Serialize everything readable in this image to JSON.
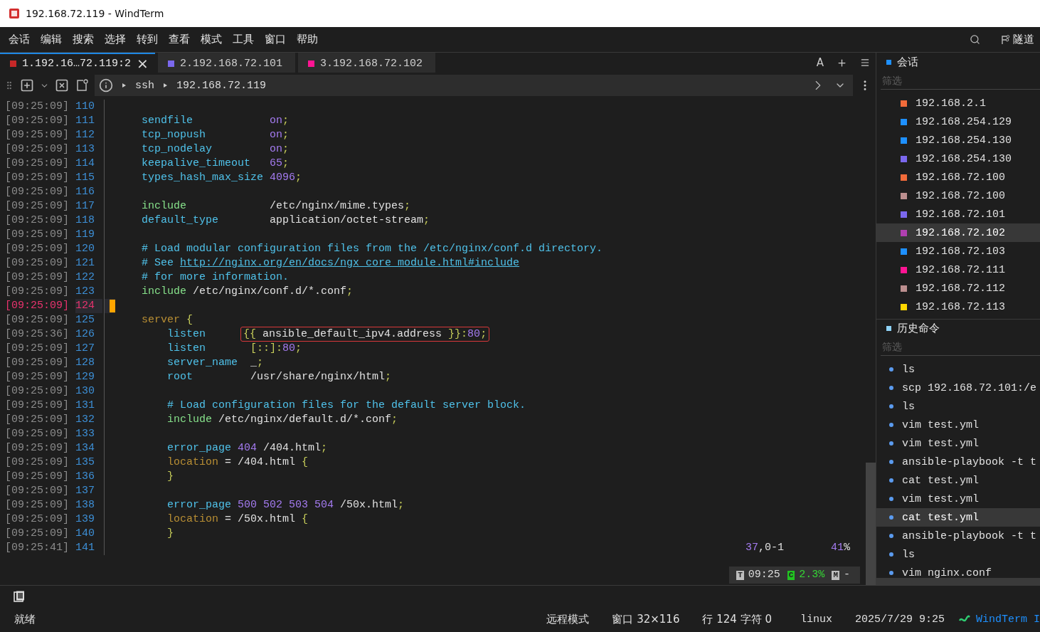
{
  "window": {
    "title": "192.168.72.119 - WindTerm"
  },
  "menu": [
    "会话",
    "编辑",
    "搜索",
    "选择",
    "转到",
    "查看",
    "模式",
    "工具",
    "窗口",
    "帮助"
  ],
  "menu_right": {
    "tunnel": "隧道"
  },
  "tabs": [
    {
      "label": "1.192.16…72.119:2",
      "color": "#c62828",
      "selected": true,
      "close": "×"
    },
    {
      "label": "2.192.168.72.101",
      "color": "#7b68ee",
      "selected": false
    },
    {
      "label": "3.192.168.72.102",
      "color": "#ff1493",
      "selected": false
    }
  ],
  "tab_tools": {
    "font": "A"
  },
  "breadcrumb": [
    "ssh",
    "192.168.72.119"
  ],
  "terminal": {
    "lines": [
      {
        "time": "[09:25:09]",
        "number": "110",
        "selected": false
      },
      {
        "time": "[09:25:09]",
        "number": "111",
        "selected": false,
        "tokens": [
          {
            "text": "    sendfile            ",
            "kind": "key"
          },
          {
            "text": "on",
            "kind": "num"
          },
          {
            "text": ";",
            "kind": "punct"
          }
        ]
      },
      {
        "time": "[09:25:09]",
        "number": "112",
        "selected": false,
        "tokens": [
          {
            "text": "    tcp_nopush          ",
            "kind": "key"
          },
          {
            "text": "on",
            "kind": "num"
          },
          {
            "text": ";",
            "kind": "punct"
          }
        ]
      },
      {
        "time": "[09:25:09]",
        "number": "113",
        "selected": false,
        "tokens": [
          {
            "text": "    tcp_nodelay         ",
            "kind": "key"
          },
          {
            "text": "on",
            "kind": "num"
          },
          {
            "text": ";",
            "kind": "punct"
          }
        ]
      },
      {
        "time": "[09:25:09]",
        "number": "114",
        "selected": false,
        "tokens": [
          {
            "text": "    keepalive_timeout   ",
            "kind": "key"
          },
          {
            "text": "65",
            "kind": "num"
          },
          {
            "text": ";",
            "kind": "punct"
          }
        ]
      },
      {
        "time": "[09:25:09]",
        "number": "115",
        "selected": false,
        "tokens": [
          {
            "text": "    types_hash_max_size ",
            "kind": "key"
          },
          {
            "text": "4096",
            "kind": "num"
          },
          {
            "text": ";",
            "kind": "punct"
          }
        ]
      },
      {
        "time": "[09:25:09]",
        "number": "116",
        "selected": false
      },
      {
        "time": "[09:25:09]",
        "number": "117",
        "selected": false,
        "tokens": [
          {
            "text": "    include             ",
            "kind": "inc"
          },
          {
            "text": "/etc/nginx/mime.types",
            "kind": "plain"
          },
          {
            "text": ";",
            "kind": "punct"
          }
        ]
      },
      {
        "time": "[09:25:09]",
        "number": "118",
        "selected": false,
        "tokens": [
          {
            "text": "    default_type        ",
            "kind": "key"
          },
          {
            "text": "application/octet-stream",
            "kind": "plain"
          },
          {
            "text": ";",
            "kind": "punct"
          }
        ]
      },
      {
        "time": "[09:25:09]",
        "number": "119",
        "selected": false
      },
      {
        "time": "[09:25:09]",
        "number": "120",
        "selected": false,
        "tokens": [
          {
            "text": "    # Load modular configuration files from the /etc/nginx/conf.d directory.",
            "kind": "comment"
          }
        ]
      },
      {
        "time": "[09:25:09]",
        "number": "121",
        "selected": false,
        "tokens": [
          {
            "text": "    # See ",
            "kind": "comment"
          },
          {
            "text": "http://nginx.org/en/docs/ngx_core_module.html#include",
            "kind": "link"
          }
        ]
      },
      {
        "time": "[09:25:09]",
        "number": "122",
        "selected": false,
        "tokens": [
          {
            "text": "    # for more information.",
            "kind": "comment"
          }
        ]
      },
      {
        "time": "[09:25:09]",
        "number": "123",
        "selected": false,
        "tokens": [
          {
            "text": "    include ",
            "kind": "inc"
          },
          {
            "text": "/etc/nginx/conf.d/*.conf",
            "kind": "plain"
          },
          {
            "text": ";",
            "kind": "punct"
          }
        ]
      },
      {
        "time": "[09:25:09]",
        "number": "124",
        "selected": true
      },
      {
        "time": "[09:25:09]",
        "number": "125",
        "selected": false,
        "tokens": [
          {
            "text": "    server ",
            "kind": "kw"
          },
          {
            "text": "{",
            "kind": "punct"
          }
        ]
      },
      {
        "time": "[09:25:36]",
        "number": "126",
        "selected": false,
        "tokens": [
          {
            "text": "        listen      ",
            "kind": "key"
          },
          {
            "kind": "group",
            "children": [
              {
                "text": "{{ ",
                "kind": "punct"
              },
              {
                "text": "ansible_default_ipv4.address ",
                "kind": "plain"
              },
              {
                "text": "}}:",
                "kind": "punct"
              },
              {
                "text": "80",
                "kind": "num"
              },
              {
                "text": ";",
                "kind": "punct"
              }
            ]
          }
        ]
      },
      {
        "time": "[09:25:09]",
        "number": "127",
        "selected": false,
        "tokens": [
          {
            "text": "        listen       ",
            "kind": "key"
          },
          {
            "text": "[::]:",
            "kind": "punct"
          },
          {
            "text": "80",
            "kind": "num"
          },
          {
            "text": ";",
            "kind": "punct"
          }
        ]
      },
      {
        "time": "[09:25:09]",
        "number": "128",
        "selected": false,
        "tokens": [
          {
            "text": "        server_name  ",
            "kind": "key"
          },
          {
            "text": "_",
            "kind": "plain"
          },
          {
            "text": ";",
            "kind": "punct"
          }
        ]
      },
      {
        "time": "[09:25:09]",
        "number": "129",
        "selected": false,
        "tokens": [
          {
            "text": "        root         ",
            "kind": "key"
          },
          {
            "text": "/usr/share/nginx/html",
            "kind": "plain"
          },
          {
            "text": ";",
            "kind": "punct"
          }
        ]
      },
      {
        "time": "[09:25:09]",
        "number": "130",
        "selected": false
      },
      {
        "time": "[09:25:09]",
        "number": "131",
        "selected": false,
        "tokens": [
          {
            "text": "        # Load configuration files for the default server block.",
            "kind": "comment"
          }
        ]
      },
      {
        "time": "[09:25:09]",
        "number": "132",
        "selected": false,
        "tokens": [
          {
            "text": "        include ",
            "kind": "inc"
          },
          {
            "text": "/etc/nginx/default.d/*.conf",
            "kind": "plain"
          },
          {
            "text": ";",
            "kind": "punct"
          }
        ]
      },
      {
        "time": "[09:25:09]",
        "number": "133",
        "selected": false
      },
      {
        "time": "[09:25:09]",
        "number": "134",
        "selected": false,
        "tokens": [
          {
            "text": "        error_page ",
            "kind": "key"
          },
          {
            "text": "404",
            "kind": "num"
          },
          {
            "text": " /404.html",
            "kind": "plain"
          },
          {
            "text": ";",
            "kind": "punct"
          }
        ]
      },
      {
        "time": "[09:25:09]",
        "number": "135",
        "selected": false,
        "tokens": [
          {
            "text": "        location ",
            "kind": "kw"
          },
          {
            "text": "= /404.html ",
            "kind": "plain"
          },
          {
            "text": "{",
            "kind": "punct"
          }
        ]
      },
      {
        "time": "[09:25:09]",
        "number": "136",
        "selected": false,
        "tokens": [
          {
            "text": "        }",
            "kind": "punct"
          }
        ]
      },
      {
        "time": "[09:25:09]",
        "number": "137",
        "selected": false
      },
      {
        "time": "[09:25:09]",
        "number": "138",
        "selected": false,
        "tokens": [
          {
            "text": "        error_page ",
            "kind": "key"
          },
          {
            "text": "500 502 503 504",
            "kind": "num"
          },
          {
            "text": " /50x.html",
            "kind": "plain"
          },
          {
            "text": ";",
            "kind": "punct"
          }
        ]
      },
      {
        "time": "[09:25:09]",
        "number": "139",
        "selected": false,
        "tokens": [
          {
            "text": "        location ",
            "kind": "kw"
          },
          {
            "text": "= /50x.html ",
            "kind": "plain"
          },
          {
            "text": "{",
            "kind": "punct"
          }
        ]
      },
      {
        "time": "[09:25:09]",
        "number": "140",
        "selected": false,
        "tokens": [
          {
            "text": "        }",
            "kind": "punct"
          }
        ]
      },
      {
        "time": "[09:25:41]",
        "number": "141",
        "selected": false
      }
    ],
    "position": [
      {
        "text": "37",
        "kind": "num"
      },
      {
        "text": ",0-1",
        "kind": "plain"
      }
    ],
    "percent": [
      {
        "text": "41",
        "kind": "num"
      },
      {
        "text": "%",
        "kind": "plain"
      }
    ],
    "monitor": [
      {
        "key": "T",
        "value": "09:25",
        "kind": "time"
      },
      {
        "key": "C",
        "value": "2.3%",
        "kind": "cpu"
      },
      {
        "key": "M",
        "value": "-",
        "kind": "mem"
      }
    ]
  },
  "sidebar": {
    "sessions": {
      "title": "会话",
      "filter_placeholder": "筛选",
      "items": [
        {
          "label": "192.168.2.1",
          "color": "#f26b3a",
          "selected": false
        },
        {
          "label": "192.168.254.129",
          "color": "#1e90ff",
          "selected": false
        },
        {
          "label": "192.168.254.130",
          "color": "#1e90ff",
          "selected": false
        },
        {
          "label": "192.168.254.130",
          "color": "#7b68ee",
          "selected": false
        },
        {
          "label": "192.168.72.100",
          "color": "#f26b3a",
          "selected": false
        },
        {
          "label": "192.168.72.100",
          "color": "#bc8f8f",
          "selected": false
        },
        {
          "label": "192.168.72.101",
          "color": "#7b68ee",
          "selected": false
        },
        {
          "label": "192.168.72.102",
          "color": "#b03fb0",
          "selected": true
        },
        {
          "label": "192.168.72.103",
          "color": "#1e90ff",
          "selected": false
        },
        {
          "label": "192.168.72.111",
          "color": "#ff1493",
          "selected": false
        },
        {
          "label": "192.168.72.112",
          "color": "#bc8f8f",
          "selected": false
        },
        {
          "label": "192.168.72.113",
          "color": "#ffd700",
          "selected": false
        }
      ]
    },
    "history": {
      "title": "历史命令",
      "filter_placeholder": "筛选",
      "items": [
        {
          "label": "ls",
          "selected": false
        },
        {
          "label": "scp 192.168.72.101:/e",
          "selected": false
        },
        {
          "label": "ls",
          "selected": false
        },
        {
          "label": "vim test.yml",
          "selected": false
        },
        {
          "label": "vim test.yml",
          "selected": false
        },
        {
          "label": "ansible-playbook -t t",
          "selected": false
        },
        {
          "label": "cat test.yml",
          "selected": false
        },
        {
          "label": "vim test.yml",
          "selected": false
        },
        {
          "label": "cat test.yml",
          "selected": true
        },
        {
          "label": "ansible-playbook -t t",
          "selected": false
        },
        {
          "label": "ls",
          "selected": false
        },
        {
          "label": "vim nginx.conf",
          "selected": false
        }
      ]
    }
  },
  "status_bar": {
    "left": "就绪",
    "items": [
      "远程模式",
      "窗口 32×116",
      "行 124 字符 0",
      "linux",
      "2025/7/29 9:25"
    ],
    "brand": "WindTerm I"
  }
}
